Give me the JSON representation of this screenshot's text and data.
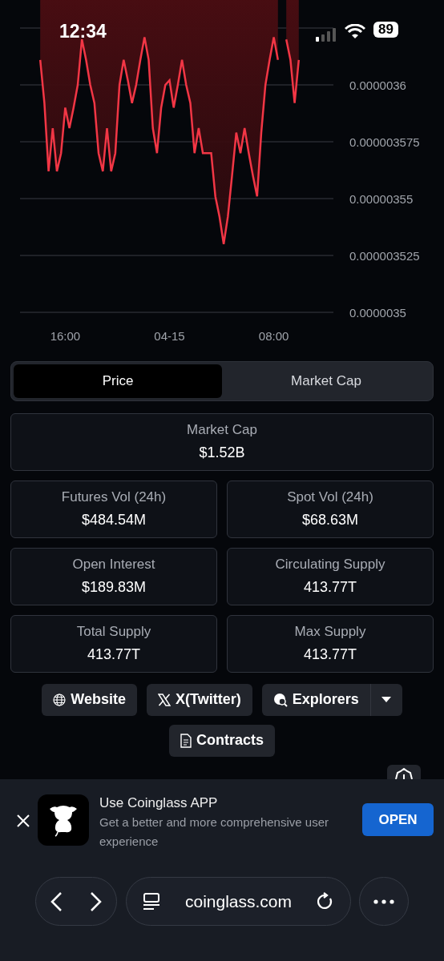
{
  "status_bar": {
    "time": "12:34",
    "battery": "89"
  },
  "chart": {
    "chart_data": {
      "type": "area",
      "categories": [
        null,
        null,
        null,
        null,
        null,
        null,
        null,
        "16:00",
        null,
        null,
        null,
        null,
        null,
        null,
        null,
        null,
        null,
        null,
        null,
        null,
        null,
        null,
        null,
        null,
        null,
        null,
        null,
        null,
        null,
        null,
        null,
        null,
        "04-15",
        null,
        null,
        null,
        null,
        null,
        null,
        null,
        null,
        null,
        null,
        null,
        null,
        null,
        null,
        null,
        null,
        null,
        null,
        null,
        null,
        null,
        null,
        null,
        null,
        "08:00",
        null,
        null,
        null,
        null,
        null,
        null,
        null
      ],
      "series": [
        {
          "color": "#f23645",
          "values": [
            null,
            3.611e-06,
            3.592e-06,
            3.562e-06,
            3.581e-06,
            3.562e-06,
            3.57e-06,
            3.59e-06,
            3.581e-06,
            3.59e-06,
            3.6e-06,
            3.62e-06,
            3.611e-06,
            3.6e-06,
            3.592e-06,
            3.57e-06,
            3.562e-06,
            3.581e-06,
            3.562e-06,
            3.57e-06,
            3.6e-06,
            3.611e-06,
            3.602e-06,
            3.592e-06,
            3.6e-06,
            3.611e-06,
            3.621e-06,
            3.611e-06,
            3.581e-06,
            3.57e-06,
            3.59e-06,
            3.6e-06,
            3.602e-06,
            3.59e-06,
            3.6e-06,
            3.611e-06,
            3.6e-06,
            3.592e-06,
            3.57e-06,
            3.581e-06,
            3.57e-06,
            3.57e-06,
            3.57e-06,
            3.551e-06,
            3.542e-06,
            3.53e-06,
            3.542e-06,
            3.56e-06,
            3.579e-06,
            3.57e-06,
            3.581e-06,
            3.57e-06,
            3.56e-06,
            3.551e-06,
            3.579e-06,
            3.6e-06,
            3.611e-06,
            3.621e-06,
            3.611e-06,
            null,
            3.62e-06,
            3.611e-06,
            3.592e-06,
            3.611e-06,
            null
          ]
        }
      ],
      "grid": true,
      "ylim": [
        3.5e-06,
        3.625e-06
      ],
      "yticks": [
        {
          "value": 3.6e-06,
          "label": "0.0000036"
        },
        {
          "value": 3.575e-06,
          "label": "0.000003575"
        },
        {
          "value": 3.55e-06,
          "label": "0.00000355"
        },
        {
          "value": 3.525e-06,
          "label": "0.000003525"
        },
        {
          "value": 3.5e-06,
          "label": "0.0000035"
        }
      ]
    }
  },
  "view_toggle": [
    {
      "label": "Price",
      "selected": true
    },
    {
      "label": "Market Cap",
      "selected": false
    }
  ],
  "stats": [
    {
      "kind": "wide",
      "label": "Market Cap",
      "value": "$1.52B"
    },
    {
      "kind": "half",
      "label": "Futures Vol (24h)",
      "value": "$484.54M"
    },
    {
      "kind": "half",
      "label": "Spot Vol (24h)",
      "value": "$68.63M"
    },
    {
      "kind": "half",
      "label": "Open Interest",
      "value": "$189.83M"
    },
    {
      "kind": "half",
      "label": "Circulating Supply",
      "value": "413.77T"
    },
    {
      "kind": "half",
      "label": "Total Supply",
      "value": "413.77T"
    },
    {
      "kind": "half",
      "label": "Max Supply",
      "value": "413.77T"
    }
  ],
  "links": [
    {
      "kind": "globe",
      "label": "Website"
    },
    {
      "kind": "x",
      "label": "X(Twitter)"
    },
    {
      "kind": "explorer",
      "label": "Explorers"
    },
    {
      "kind": "doc",
      "label": "Contracts"
    }
  ],
  "app_banner": {
    "title": "Use Coinglass APP",
    "text": "Get a better and more comprehensive user experience",
    "button": "OPEN"
  },
  "browser": {
    "url": "coinglass.com"
  }
}
